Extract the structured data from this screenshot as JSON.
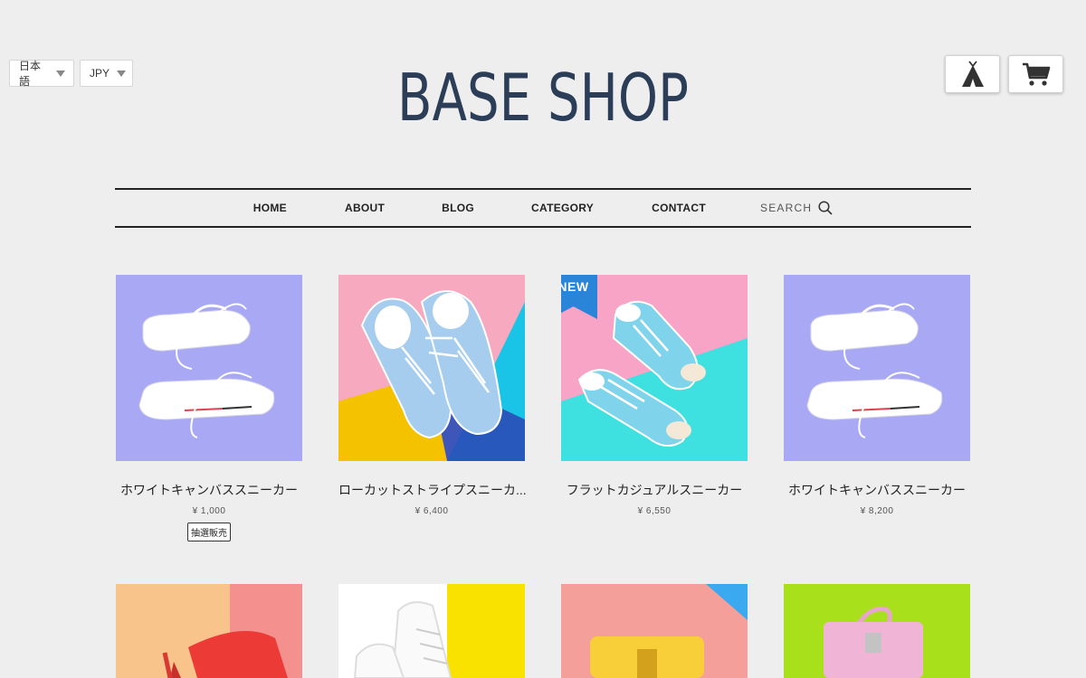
{
  "header": {
    "language": "日本語",
    "currency": "JPY",
    "logo": "BASE SHOP"
  },
  "nav": {
    "home": "HOME",
    "about": "ABOUT",
    "blog": "BLOG",
    "category": "CATEGORY",
    "contact": "CONTACT",
    "search": "SEARCH"
  },
  "colors": {
    "logo": "#2b3d57",
    "background": "#eeeeee",
    "new_ribbon": "#2a84d8"
  },
  "products": [
    {
      "name": "ホワイトキャンバススニーカー",
      "price": "¥ 1,000",
      "tag": "抽選販売"
    },
    {
      "name": "ローカットストライプスニーカ...",
      "price": "¥ 6,400"
    },
    {
      "name": "フラットカジュアルスニーカー",
      "price": "¥ 6,550",
      "badge": "NEW"
    },
    {
      "name": "ホワイトキャンバススニーカー",
      "price": "¥ 8,200"
    }
  ]
}
